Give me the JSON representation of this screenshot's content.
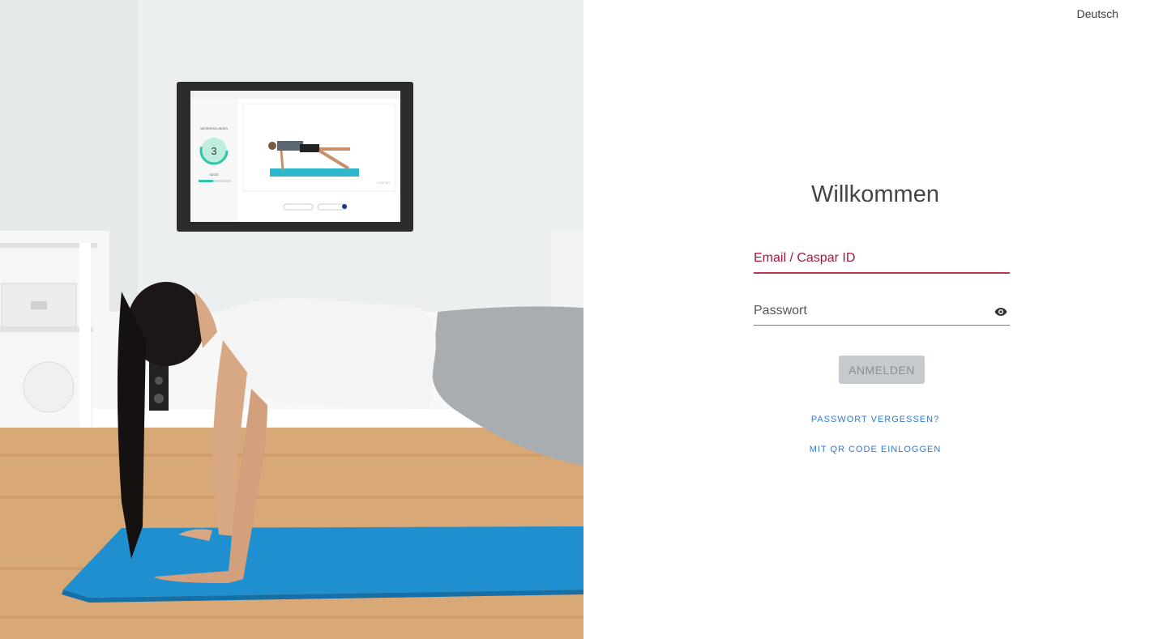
{
  "language": {
    "label": "Deutsch"
  },
  "login": {
    "title": "Willkommen",
    "email_label": "Email / Caspar ID",
    "password_label": "Passwort",
    "submit_label": "ANMELDEN",
    "forgot_label": "PASSWORT VERGESSEN?",
    "qr_label": "MIT QR CODE EINLOGGEN"
  },
  "hero_tv": {
    "reps_label": "WIEDERHOLUNGEN",
    "reps_value": "3",
    "sets_label": "SÄTZE",
    "brand": "CASPAR"
  },
  "colors": {
    "accent": "#a3183d",
    "link": "#2f7ad0",
    "button_disabled": "#c5cacf",
    "mat": "#1f8fd0"
  },
  "icons": {
    "password_toggle": "eye-icon"
  }
}
